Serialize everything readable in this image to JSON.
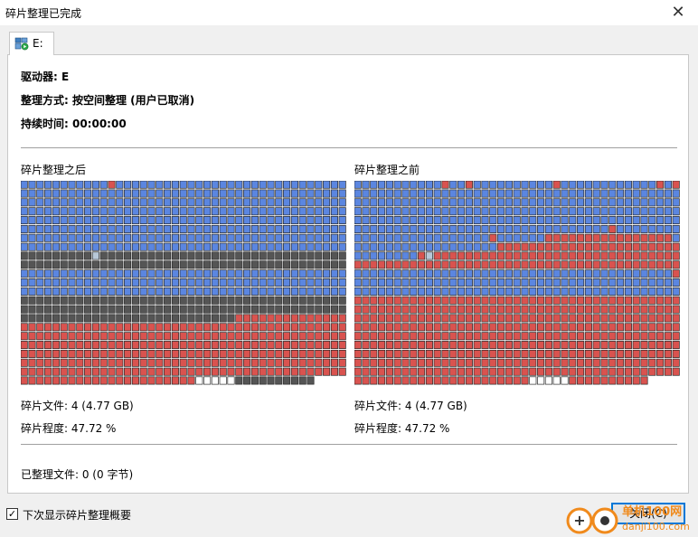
{
  "window": {
    "title": "碎片整理已完成",
    "close_glyph": "✕"
  },
  "tab": {
    "label": "E:",
    "icon": "disk-icon"
  },
  "info": {
    "drive": "驱动器: E",
    "method": "整理方式: 按空间整理 (用户已取消)",
    "duration": "持续时间: 00:00:00"
  },
  "after": {
    "title": "碎片整理之后",
    "files": "碎片文件: 4 (4.77 GB)",
    "degree": "碎片程度: 47.72 %"
  },
  "before": {
    "title": "碎片整理之前",
    "files": "碎片文件: 4 (4.77 GB)",
    "degree": "碎片程度: 47.72 %"
  },
  "defragged_files": "已整理文件: 0 (0 字节)",
  "show_summary": {
    "label": "下次显示碎片整理概要",
    "checked": true,
    "glyph": "✓"
  },
  "close_button": {
    "label": "关闭(C)"
  },
  "watermark": {
    "text": "单机100网",
    "url": "danji100.com"
  },
  "colors": {
    "blue": "#5b86e0",
    "red": "#d9534f",
    "dark": "#555555",
    "white": "#ffffff",
    "border": "#2a2a2a"
  },
  "legend": {
    "B": "blue block (contiguous file)",
    "R": "red block (fragmented file)",
    "D": "dark gray block",
    "W": "white block (free space)",
    "G": "light / system block"
  },
  "after_map": [
    "BBBBBBBBBBBRBBBBBBBBBBBBBBBBBBBBBBBBBBBBB",
    "BBBBBBBBBBBBBBBBBBBBBBBBBBBBBBBBBBBBBBBBB",
    "BBBBBBBBBBBBBBBBBBBBBBBBBBBBBBBBBBBBBBBBB",
    "BBBBBBBBBBBBBBBBBBBBBBBBBBBBBBBBBBBBBBBBB",
    "BBBBBBBBBBBBBBBBBBBBBBBBBBBBBBBBBBBBBBBBB",
    "BBBBBBBBBBBBBBBBBBBBBBBBBBBBBBBBBBBBBBBBB",
    "BBBBBBBBBBBBBBBBBBBBBBBBBBBBBBBBBBBBBBBBB",
    "BBBBBBBBBBBBBBBBBBBBBBBBBBBBBBBBBBBBBBBBB",
    "DDDDDDDDDGDDDDDDDDDDDDDDDDDDDDDDDDDDDDDDD",
    "DDDDDDDDDDDDDDDDDDDDDDDDDDDDDDDDDDDDDDDDD",
    "BBBBBBBBBBBBBBBBBBBBBBBBBBBBBBBBBBBBBBBBB",
    "BBBBBBBBBBBBBBBBBBBBBBBBBBBBBBBBBBBBBBBBB",
    "BBBBBBBBBBBBBBBBBBBBBBBBBBBBBBBBBBBBBBBBB",
    "DDDDDDDDDDDDDDDDDDDDDDDDDDDDDDDDDDDDDDDDD",
    "DDDDDDDDDDDDDDDDDDDDDDDDDDDDDDDDDDDDDDDDD",
    "DDDDDDDDDDDDDDDDDDDDDDDDDDDRRRRRRRRRRRRRR",
    "RRRRRRRRRRRRRRRRRRRRRRRRRRRRRRRRRRRRRRRRR",
    "RRRRRRRRRRRRRRRRRRRRRRRRRRRRRRRRRRRRRRRRR",
    "RRRRRRRRRRRRRRRRRRRRRRRRRRRRRRRRRRRRRRRRR",
    "RRRRRRRRRRRRRRRRRRRRRRRRRRRRRRRRRRRRRRRRR",
    "RRRRRRRRRRRRRRRRRRRRRRRRRRRRRRRRRRRRRRRRR",
    "RRRRRRRRRRRRRRRRRRRRRRRRRRRRRRRRRRRRRRRRR",
    "RRRRRRRRRRRRRRRRRRRRRRWWWWWDDDDDDDDDD"
  ],
  "before_map": [
    "BBBBBBBBBBBRBBRBBBBBBBBBBRBBBBBBBBBBBBRBR",
    "BBBBBBBBBBBBBBBBBBBBBBBBBBBBBBBBBBBBBBBBB",
    "BBBBBBBBBBBBBBBBBBBBBBBBBBBBBBBBBBBBBBBBB",
    "BBBBBBBBBBBBBBBBBBBBBBBBBBBBBBBBBBBBBBBBB",
    "BBBBBBBBBBBBBBBBBBBBBBBBBBBBBBBBBBBBBBBBB",
    "BBBBBBBBBBBBBBBBBBBBBBBBBBBBBBBBRBBBBBBBB",
    "BBBBBBBBBBBBBBBBBRBBBBBBRRRRRRRRRRRRRRRRB",
    "BBBBBBBBBBBBBBBBBBRRRRRRRRRRRRRRRRRRRRRRR",
    "BBBBBBBBRGRRRRRRRRRRRRRRRRRRRRRRRRRRRRRRR",
    "RRRRRRRRRRRRRRRRRRRRRRRRRRRRRRRRRRRRRRRRR",
    "BBBBBBBBBBBBBBBBBBBBBBBBBBBBBBBBBBBBBBBBR",
    "BBBBBBBBBBBBBBBBBBBBBBBBBBBBBBBBBBBBBBBBB",
    "BBBBBBBBBBBBBBBBBBBBBBBBBBBBBBBBBBBBBBBBB",
    "RRRRRRRRRRRRRRRRRRRRRRRRRRRRRRRRRRRRRRRRR",
    "RRRRRRRRRRRRRRRRRRRRRRRRRRRRRRRRRRRRRRRRR",
    "RRRRRRRRRRRRRRRRRRRRRRRRRRRRRRRRRRRRRRRRR",
    "RRRRRRRRRRRRRRRRRRRRRRRRRRRRRRRRRRRRRRRRR",
    "RRRRRRRRRRRRRRRRRRRRRRRRRRRRRRRRRRRRRRRRR",
    "RRRRRRRRRRRRRRRRRRRRRRRRRRRRRRRRRRRRRRRRR",
    "RRRRRRRRRRRRRRRRRRRRRRRRRRRRRRRRRRRRRRRRR",
    "RRRRRRRRRRRRRRRRRRRRRRRRRRRRRRRRRRRRRRRRR",
    "RRRRRRRRRRRRRRRRRRRRRRRRRRRRRRRRRRRRRRRRR",
    "RRRRRRRRRRRRRRRRRRRRRRWWWWWRRRRRRRRRR"
  ]
}
